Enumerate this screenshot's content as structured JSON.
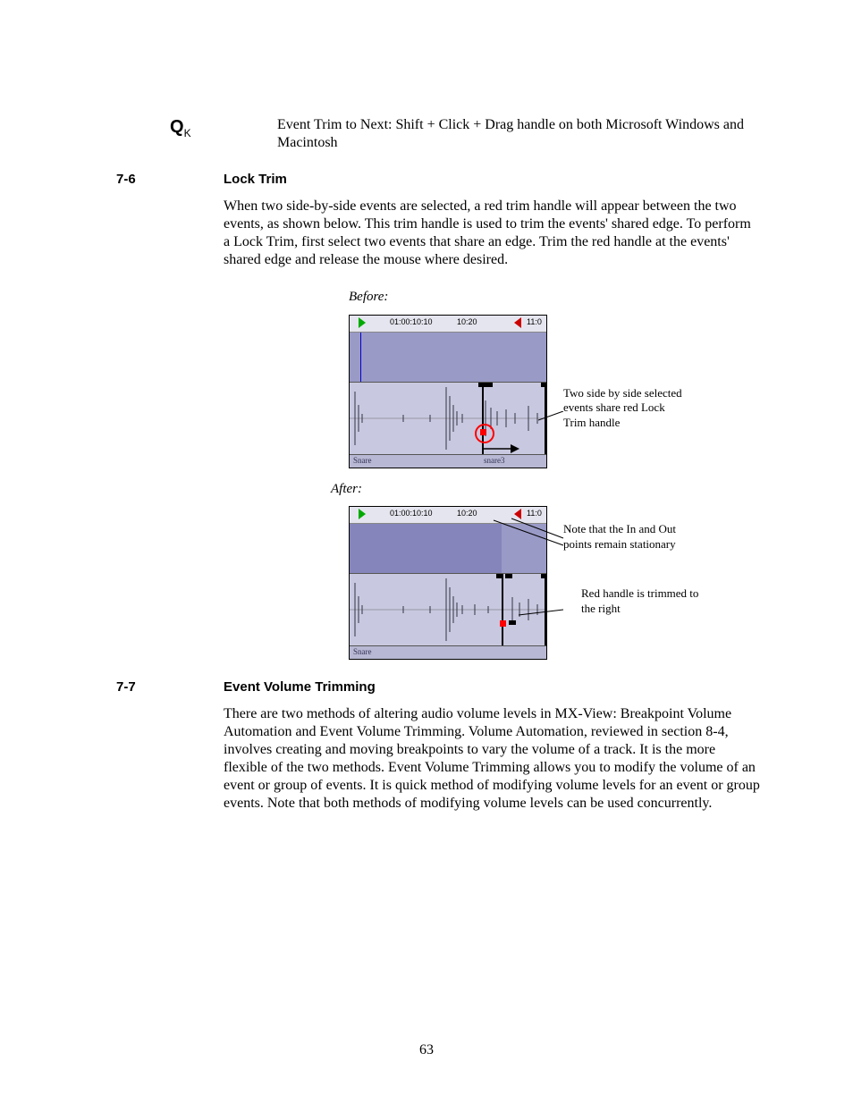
{
  "qk": {
    "symbol": "Q",
    "sub": "K",
    "text": "Event Trim to Next: Shift + Click + Drag handle on both Microsoft Windows and Macintosh"
  },
  "sections": {
    "s76": {
      "num": "7-6",
      "title": "Lock Trim",
      "body": "When two side-by-side events are selected, a red trim handle will appear between the two events, as shown below. This trim handle is used to trim the events' shared edge. To perform a Lock Trim, first select two events that share an edge. Trim the red handle at the events' shared edge and release the mouse where desired."
    },
    "s77": {
      "num": "7-7",
      "title": "Event Volume Trimming",
      "body": "There are two methods of altering audio volume levels in MX-View: Breakpoint Volume Automation and Event Volume Trimming.  Volume Automation, reviewed in section 8-4, involves creating and moving breakpoints to vary the volume of a track. It is the more flexible of the two methods. Event Volume Trimming allows you to modify the volume of an event or group of events. It is quick method of modifying volume levels for an event or group events. Note that both methods of modifying volume levels can be used concurrently."
    }
  },
  "figures": {
    "before": {
      "label": "Before:",
      "ruler": {
        "t1": "01:00:10:10",
        "t2": "10:20",
        "t3": "11:0"
      },
      "clips": {
        "left": "Snare",
        "right": "snare3"
      },
      "annotation": "Two side by side selected events share red Lock Trim handle"
    },
    "after": {
      "label": "After:",
      "ruler": {
        "t1": "01:00:10:10",
        "t2": "10:20",
        "t3": "11:0"
      },
      "clips": {
        "left": "Snare"
      },
      "annotation1": "Note that the In and Out points remain stationary",
      "annotation2": "Red handle is trimmed to the right"
    }
  },
  "pageNumber": "63"
}
